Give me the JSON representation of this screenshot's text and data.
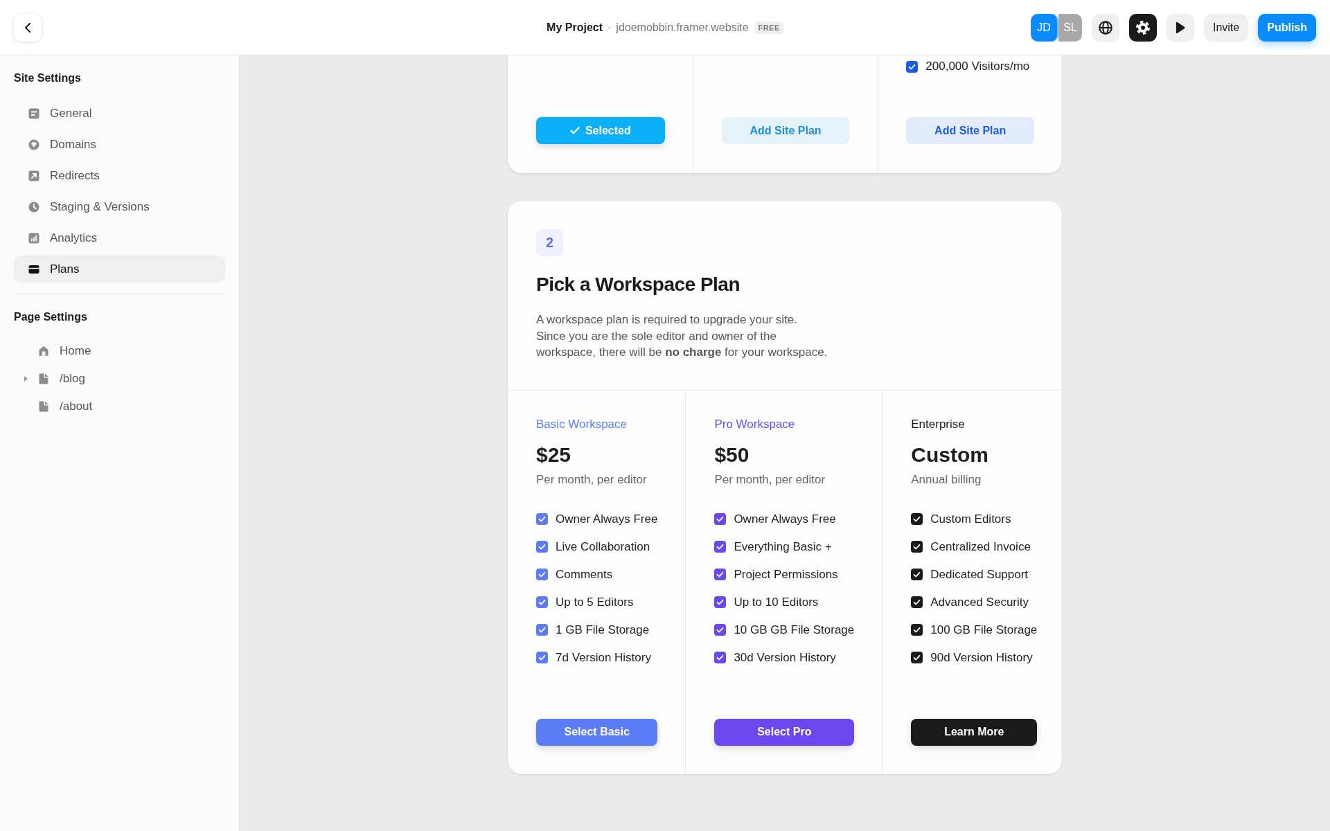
{
  "header": {
    "project": "My Project",
    "separator": "·",
    "domain": "jdoemobbin.framer.website",
    "badge": "FREE",
    "avatars": [
      {
        "initials": "JD",
        "color": "#0a8cff"
      },
      {
        "initials": "SL",
        "color": "#a9a9a9"
      }
    ],
    "tools": [
      {
        "kind": "globe",
        "selected": false
      },
      {
        "kind": "settings",
        "selected": true
      },
      {
        "kind": "play",
        "selected": false
      }
    ],
    "buttons": [
      {
        "label": "Invite",
        "kind": "secondary"
      },
      {
        "label": "Publish",
        "kind": "primary"
      }
    ]
  },
  "sidebar": {
    "site_settings": {
      "title": "Site Settings",
      "items": [
        {
          "label": "General",
          "kind": "general",
          "selected": false
        },
        {
          "label": "Domains",
          "kind": "domains",
          "selected": false
        },
        {
          "label": "Redirects",
          "kind": "redirects",
          "selected": false
        },
        {
          "label": "Staging & Versions",
          "kind": "staging",
          "selected": false
        },
        {
          "label": "Analytics",
          "kind": "analytics",
          "selected": false
        },
        {
          "label": "Plans",
          "kind": "plans",
          "selected": true
        }
      ]
    },
    "page_settings": {
      "title": "Page Settings",
      "pages": [
        {
          "label": "Home",
          "kind": "home"
        },
        {
          "label": "/blog",
          "kind": "page",
          "expanded": false
        },
        {
          "label": "/about",
          "kind": "page"
        }
      ]
    }
  },
  "site_plan_card": {
    "columns": [
      {
        "color": "#0bb0f8",
        "button": {
          "label": "Selected",
          "selected": true
        }
      },
      {
        "color": "#1e8fd8",
        "button": {
          "label": "Add Site Plan",
          "selected": false
        }
      },
      {
        "color": "#1a5ce8",
        "features": [
          {
            "label": "200,000 Visitors/mo",
            "checked": true
          }
        ],
        "button": {
          "label": "Add Site Plan",
          "selected": false
        }
      }
    ]
  },
  "workspace_card": {
    "step": "2",
    "title": "Pick a Workspace Plan",
    "description": "A workspace plan is required to upgrade your site. Since you are the sole editor and owner of the workspace, there will be **no charge** for your workspace.",
    "plans": [
      {
        "name": "Basic Workspace",
        "color": "#5b7cf5",
        "price": "$25",
        "billing": "Per month, per editor",
        "features": [
          {
            "label": "Owner Always Free",
            "checked": true
          },
          {
            "label": "Live Collaboration",
            "checked": true
          },
          {
            "label": "Comments",
            "checked": true
          },
          {
            "label": "Up to 5 Editors",
            "checked": true
          },
          {
            "label": "1 GB File Storage",
            "checked": true
          },
          {
            "label": "7d Version History",
            "checked": true
          }
        ],
        "button": "Select Basic"
      },
      {
        "name": "Pro Workspace",
        "color": "#6a48ee",
        "price": "$50",
        "billing": "Per month, per editor",
        "features": [
          {
            "label": "Owner Always Free",
            "checked": true
          },
          {
            "label": "Everything Basic +",
            "checked": true
          },
          {
            "label": "Project Permissions",
            "checked": true
          },
          {
            "label": "Up to 10 Editors",
            "checked": true
          },
          {
            "label": "10 GB GB File Storage",
            "checked": true
          },
          {
            "label": "30d Version History",
            "checked": true
          }
        ],
        "button": "Select Pro"
      },
      {
        "name": "Enterprise",
        "color": "#1a1a1a",
        "price": "Custom",
        "billing": "Annual billing",
        "features": [
          {
            "label": "Custom Editors",
            "checked": true
          },
          {
            "label": "Centralized Invoice",
            "checked": true
          },
          {
            "label": "Dedicated Support",
            "checked": true
          },
          {
            "label": "Advanced Security",
            "checked": true
          },
          {
            "label": "100 GB File Storage",
            "checked": true
          },
          {
            "label": "90d Version History",
            "checked": true
          }
        ],
        "button": "Learn More"
      }
    ]
  }
}
